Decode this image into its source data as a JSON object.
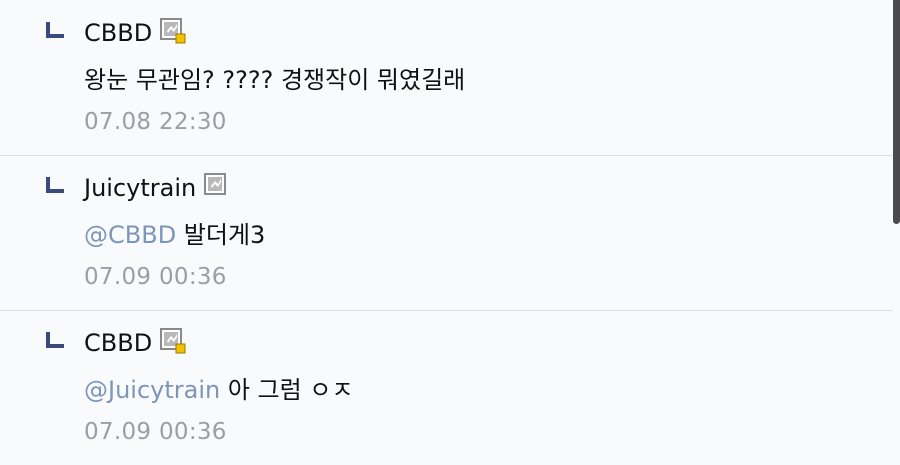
{
  "comments": [
    {
      "nick": "CBBD",
      "mention": "",
      "text": "왕눈 무관임? ???? 경쟁작이 뭐였길래",
      "time": "07.08 22:30",
      "level_icon": "level-badge-icon-new"
    },
    {
      "nick": "Juicytrain",
      "mention": "@CBBD",
      "text": " 발더게3",
      "time": "07.09 00:36",
      "level_icon": "level-badge-icon"
    },
    {
      "nick": "CBBD",
      "mention": "@Juicytrain",
      "text": " 아 그럼 ㅇㅈ",
      "time": "07.09 00:36",
      "level_icon": "level-badge-icon-new"
    }
  ],
  "colors": {
    "background": "#f9fafc",
    "mention": "#7b96b9",
    "timestamp": "#9a9ea6",
    "reply_arrow": "#3b4a7a",
    "new_badge": "#f2c200"
  }
}
